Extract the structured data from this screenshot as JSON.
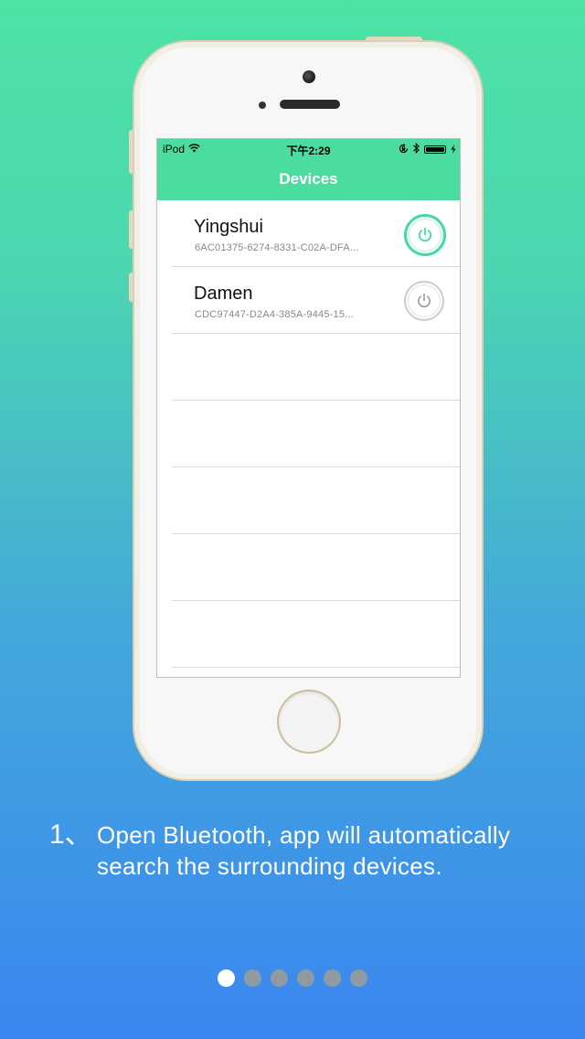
{
  "status_bar": {
    "carrier": "iPod",
    "time": "下午2:29"
  },
  "nav": {
    "title": "Devices"
  },
  "devices": [
    {
      "name": "Yingshui",
      "uuid": "6AC01375-6274-8331-C02A-DFA...",
      "connected": true
    },
    {
      "name": "Damen",
      "uuid": "CDC97447-D2A4-385A-9445-15...",
      "connected": false
    }
  ],
  "caption": {
    "number": "1、",
    "text": "Open Bluetooth, app will automatically search the surrounding devices."
  },
  "pagination": {
    "total": 6,
    "current": 1
  },
  "colors": {
    "accent": "#4cdc9f",
    "power_on": "#45d9a7",
    "power_off": "#cccccc"
  },
  "icons": [
    "wifi-icon",
    "orientation-lock-icon",
    "bluetooth-icon",
    "battery-icon",
    "charging-icon",
    "power-icon"
  ]
}
